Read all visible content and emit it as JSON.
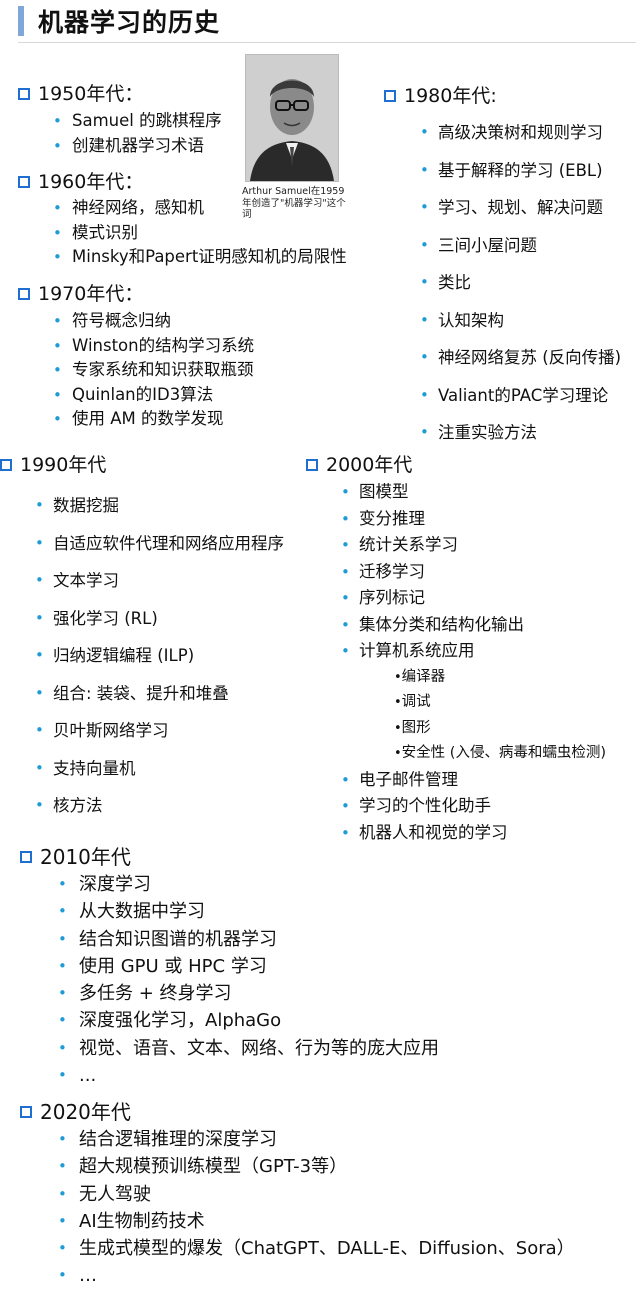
{
  "title": "机器学习的历史",
  "bullet": "•",
  "colors": {
    "heading_square": "#1f6fd0",
    "bullet": "#1f9bd6",
    "title_bar": "#7fa8d8"
  },
  "photo": {
    "caption": "Arthur Samuel在1959年创造了\"机器学习\"这个词"
  },
  "s1950": {
    "heading": "1950年代：",
    "items": [
      "Samuel 的跳棋程序",
      "创建机器学习术语"
    ]
  },
  "s1960": {
    "heading": "1960年代：",
    "items": [
      "神经网络，感知机",
      "模式识别",
      "Minsky和Papert证明感知机的局限性"
    ]
  },
  "s1970": {
    "heading": "1970年代：",
    "items": [
      "符号概念归纳",
      "Winston的结构学习系统",
      "专家系统和知识获取瓶颈",
      "Quinlan的ID3算法",
      "使用 AM 的数学发现"
    ]
  },
  "s1980": {
    "heading": "1980年代:",
    "items": [
      "高级决策树和规则学习",
      "基于解释的学习 (EBL)",
      "学习、规划、解决问题",
      "三间小屋问题",
      "类比",
      "认知架构",
      "神经网络复苏 (反向传播)",
      "Valiant的PAC学习理论",
      "注重实验方法"
    ]
  },
  "s1990": {
    "heading": "1990年代",
    "items": [
      "数据挖掘",
      "自适应软件代理和网络应用程序",
      "文本学习",
      "强化学习 (RL)",
      "归纳逻辑编程 (ILP)",
      "组合: 装袋、提升和堆叠",
      "贝叶斯网络学习",
      "支持向量机",
      "核方法"
    ]
  },
  "s2000": {
    "heading": "2000年代",
    "items_a": [
      "图模型",
      "变分推理",
      "统计关系学习",
      "迁移学习",
      "序列标记",
      "集体分类和结构化输出",
      "计算机系统应用"
    ],
    "sub_items": [
      "编译器",
      "调试",
      "图形",
      "安全性 (入侵、病毒和蠕虫检测)"
    ],
    "items_b": [
      "电子邮件管理",
      "学习的个性化助手",
      "机器人和视觉的学习"
    ]
  },
  "s2010": {
    "heading": "2010年代",
    "items": [
      "深度学习",
      "从大数据中学习",
      "结合知识图谱的机器学习",
      "使用 GPU 或 HPC 学习",
      "多任务 + 终身学习",
      "深度强化学习，AlphaGo",
      "视觉、语音、文本、网络、行为等的庞大应用",
      "..."
    ]
  },
  "s2020": {
    "heading": "2020年代",
    "items": [
      "结合逻辑推理的深度学习",
      "超大规模预训练模型（GPT-3等）",
      "无人驾驶",
      "AI生物制药技术",
      "生成式模型的爆发（ChatGPT、DALL-E、Diffusion、Sora）",
      "…"
    ]
  }
}
